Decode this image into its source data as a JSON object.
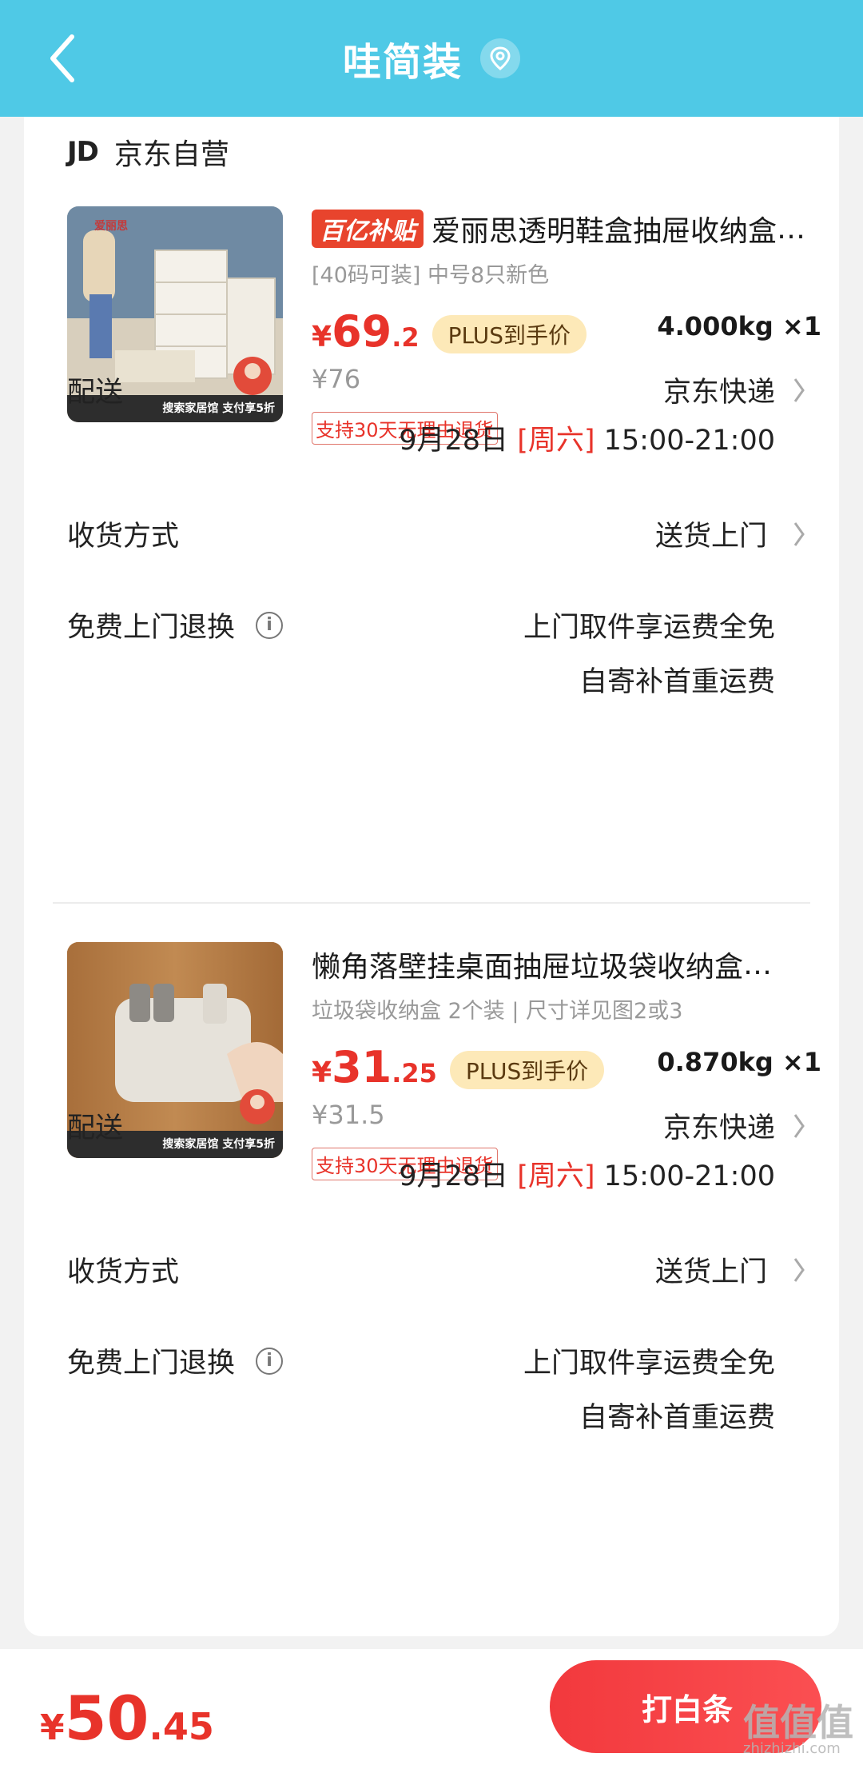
{
  "header": {
    "title": "哇简装"
  },
  "store": {
    "logo": "JD",
    "name": "京东自营"
  },
  "products": [
    {
      "subsidy_badge": "百亿补贴",
      "title": "爱丽思透明鞋盒抽屉收纳盒",
      "spec": "[40码可装] 中号8只新色",
      "price_yen": "¥",
      "price_int": "69",
      "price_dec": ".2",
      "plus_label": "PLUS到手价",
      "weight_qty": "4.000kg ×1",
      "original_price": "¥76",
      "returns_tag": "支持30天无理由退货",
      "thumb_brand": "爱丽思",
      "thumb_banner": "搜索家居馆 支付享5折"
    },
    {
      "title": "懒角落壁挂桌面抽屉垃圾袋收纳盒",
      "spec": "垃圾袋收纳盒 2个装 | 尺寸详见图2或3",
      "price_yen": "¥",
      "price_int": "31",
      "price_dec": ".25",
      "plus_label": "PLUS到手价",
      "weight_qty": "0.870kg ×1",
      "original_price": "¥31.5",
      "returns_tag": "支持30天无理由退货",
      "thumb_banner": "搜索家居馆 支付享5折"
    }
  ],
  "sections": [
    {
      "delivery_label": "配送",
      "delivery_value": "京东快递",
      "delivery_date": "9月28日",
      "delivery_weekday": "[周六]",
      "delivery_time": "15:00-21:00",
      "receive_label": "收货方式",
      "receive_value": "送货上门",
      "return_label": "免费上门退换",
      "return_value_1": "上门取件享运费全免",
      "return_value_2": "自寄补首重运费"
    },
    {
      "delivery_label": "配送",
      "delivery_value": "京东快递",
      "delivery_date": "9月28日",
      "delivery_weekday": "[周六]",
      "delivery_time": "15:00-21:00",
      "receive_label": "收货方式",
      "receive_value": "送货上门",
      "return_label": "免费上门退换",
      "return_value_1": "上门取件享运费全免",
      "return_value_2": "自寄补首重运费"
    }
  ],
  "bottom": {
    "total_yen": "¥",
    "total_int": "50",
    "total_dec": ".45",
    "pay_button": "打白条",
    "watermark": "值值值",
    "watermark_url": "zhizhizhi.com"
  },
  "colors": {
    "header_bg": "#4fc9e6",
    "accent_red": "#e8332a",
    "plus_bg": "#fde9b8"
  }
}
